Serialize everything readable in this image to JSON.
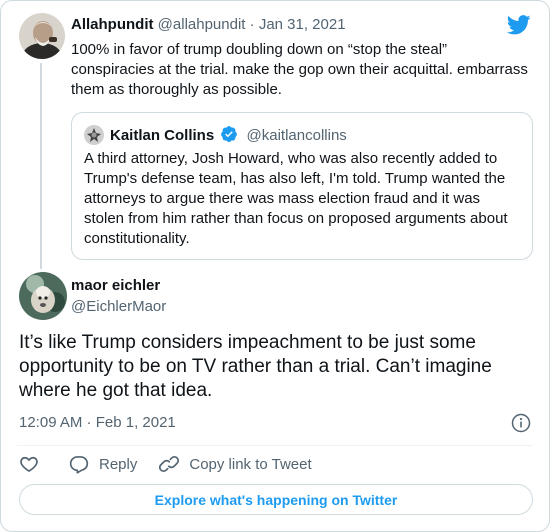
{
  "parent_tweet": {
    "author_name": "Allahpundit",
    "author_handle": "@allahpundit",
    "separator": "·",
    "date": "Jan 31, 2021",
    "text": "100% in favor of trump doubling down on “stop the steal” conspiracies at the trial. make the gop own their acquittal. embarrass them as thoroughly as possible."
  },
  "quoted_tweet": {
    "author_name": "Kaitlan Collins",
    "author_handle": "@kaitlancollins",
    "verified": true,
    "text": "A third attorney, Josh Howard, who was also recently added to Trump's defense team, has also left, I'm told. Trump wanted the attorneys to argue there was mass election fraud and it was stolen from him rather than focus on proposed arguments about constitutionality."
  },
  "main_tweet": {
    "author_name": "maor eichler",
    "author_handle": "@EichlerMaor",
    "text": "It’s like Trump considers impeachment to be just some opportunity to be on TV rather than a trial. Can’t imagine where he got that idea.",
    "timestamp": "12:09 AM · Feb 1, 2021"
  },
  "actions": {
    "reply_label": "Reply",
    "copy_link_label": "Copy link to Tweet"
  },
  "explore_label": "Explore what's happening on Twitter",
  "colors": {
    "accent": "#1d9bf0",
    "text_primary": "#0f1419",
    "text_secondary": "#536471",
    "border": "#cfd9de"
  },
  "icons": [
    "twitter-bird-icon",
    "verified-badge-icon",
    "info-icon",
    "heart-icon",
    "reply-icon",
    "link-icon"
  ]
}
